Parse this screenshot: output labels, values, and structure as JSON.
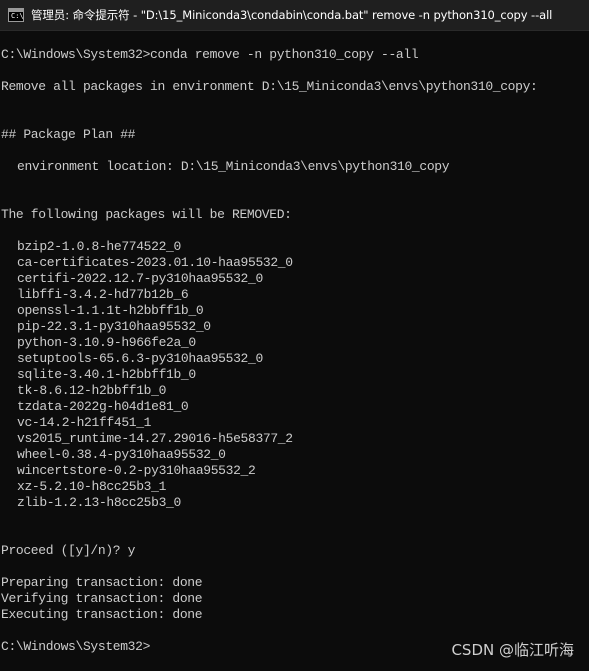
{
  "window": {
    "title": "管理员: 命令提示符 - \"D:\\15_Miniconda3\\condabin\\conda.bat\"  remove -n python310_copy --all",
    "icon": "cmd-icon",
    "icon_glyph": "C:\\"
  },
  "console": {
    "command_line": "C:\\Windows\\System32>conda remove -n python310_copy --all",
    "remove_message": "Remove all packages in environment D:\\15_Miniconda3\\envs\\python310_copy:",
    "plan_header": "## Package Plan ##",
    "environment_location": "environment location: D:\\15_Miniconda3\\envs\\python310_copy",
    "removed_header": "The following packages will be REMOVED:",
    "packages": [
      "bzip2-1.0.8-he774522_0",
      "ca-certificates-2023.01.10-haa95532_0",
      "certifi-2022.12.7-py310haa95532_0",
      "libffi-3.4.2-hd77b12b_6",
      "openssl-1.1.1t-h2bbff1b_0",
      "pip-22.3.1-py310haa95532_0",
      "python-3.10.9-h966fe2a_0",
      "setuptools-65.6.3-py310haa95532_0",
      "sqlite-3.40.1-h2bbff1b_0",
      "tk-8.6.12-h2bbff1b_0",
      "tzdata-2022g-h04d1e81_0",
      "vc-14.2-h21ff451_1",
      "vs2015_runtime-14.27.29016-h5e58377_2",
      "wheel-0.38.4-py310haa95532_0",
      "wincertstore-0.2-py310haa95532_2",
      "xz-5.2.10-h8cc25b3_1",
      "zlib-1.2.13-h8cc25b3_0"
    ],
    "proceed_prompt": "Proceed ([y]/n)? y",
    "transaction_lines": [
      "Preparing transaction: done",
      "Verifying transaction: done",
      "Executing transaction: done"
    ],
    "final_prompt": "C:\\Windows\\System32>"
  },
  "watermark": "CSDN @临江听海",
  "colors": {
    "background": "#0c0c0c",
    "text": "#cccccc",
    "titlebar": "#1f1f1f"
  }
}
